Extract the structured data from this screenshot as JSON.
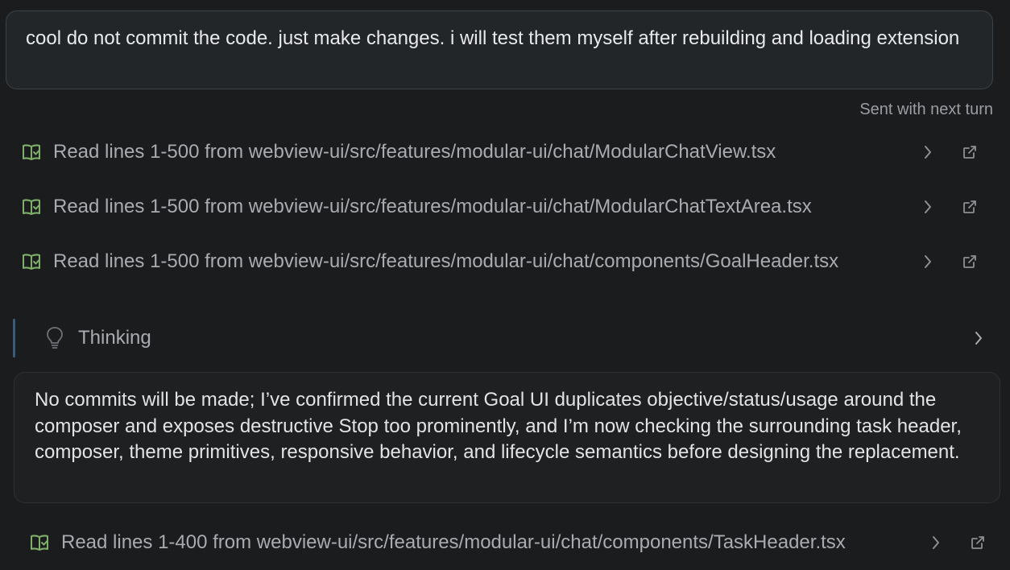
{
  "user_message": {
    "text": "cool do not commit the code. just make changes. i will test them myself after rebuilding and loading extension"
  },
  "sent_note": "Sent with next turn",
  "read_items": [
    {
      "label": "Read lines 1-500 from webview-ui/src/features/modular-ui/chat/ModularChatView.tsx"
    },
    {
      "label": "Read lines 1-500 from webview-ui/src/features/modular-ui/chat/ModularChatTextArea.tsx"
    },
    {
      "label": "Read lines 1-500 from webview-ui/src/features/modular-ui/chat/components/GoalHeader.tsx"
    }
  ],
  "thinking": {
    "label": "Thinking"
  },
  "assistant_message": {
    "text": "No commits will be made; I’ve confirmed the current Goal UI duplicates objective/status/usage around the composer and exposes destructive Stop too prominently, and I’m now checking the surrounding task header, composer, theme primitives, responsive behavior, and lifecycle semantics before designing the replacement."
  },
  "read_items_after": [
    {
      "label": "Read lines 1-400 from webview-ui/src/features/modular-ui/chat/components/TaskHeader.tsx"
    }
  ],
  "colors": {
    "background": "#1b1c1e",
    "book_icon": "#7fb069",
    "thinking_bar": "#3f5a72"
  },
  "icons": {
    "read": "book-check-icon",
    "expand": "chevron-right-icon",
    "open": "external-link-icon",
    "thinking": "lightbulb-icon"
  }
}
